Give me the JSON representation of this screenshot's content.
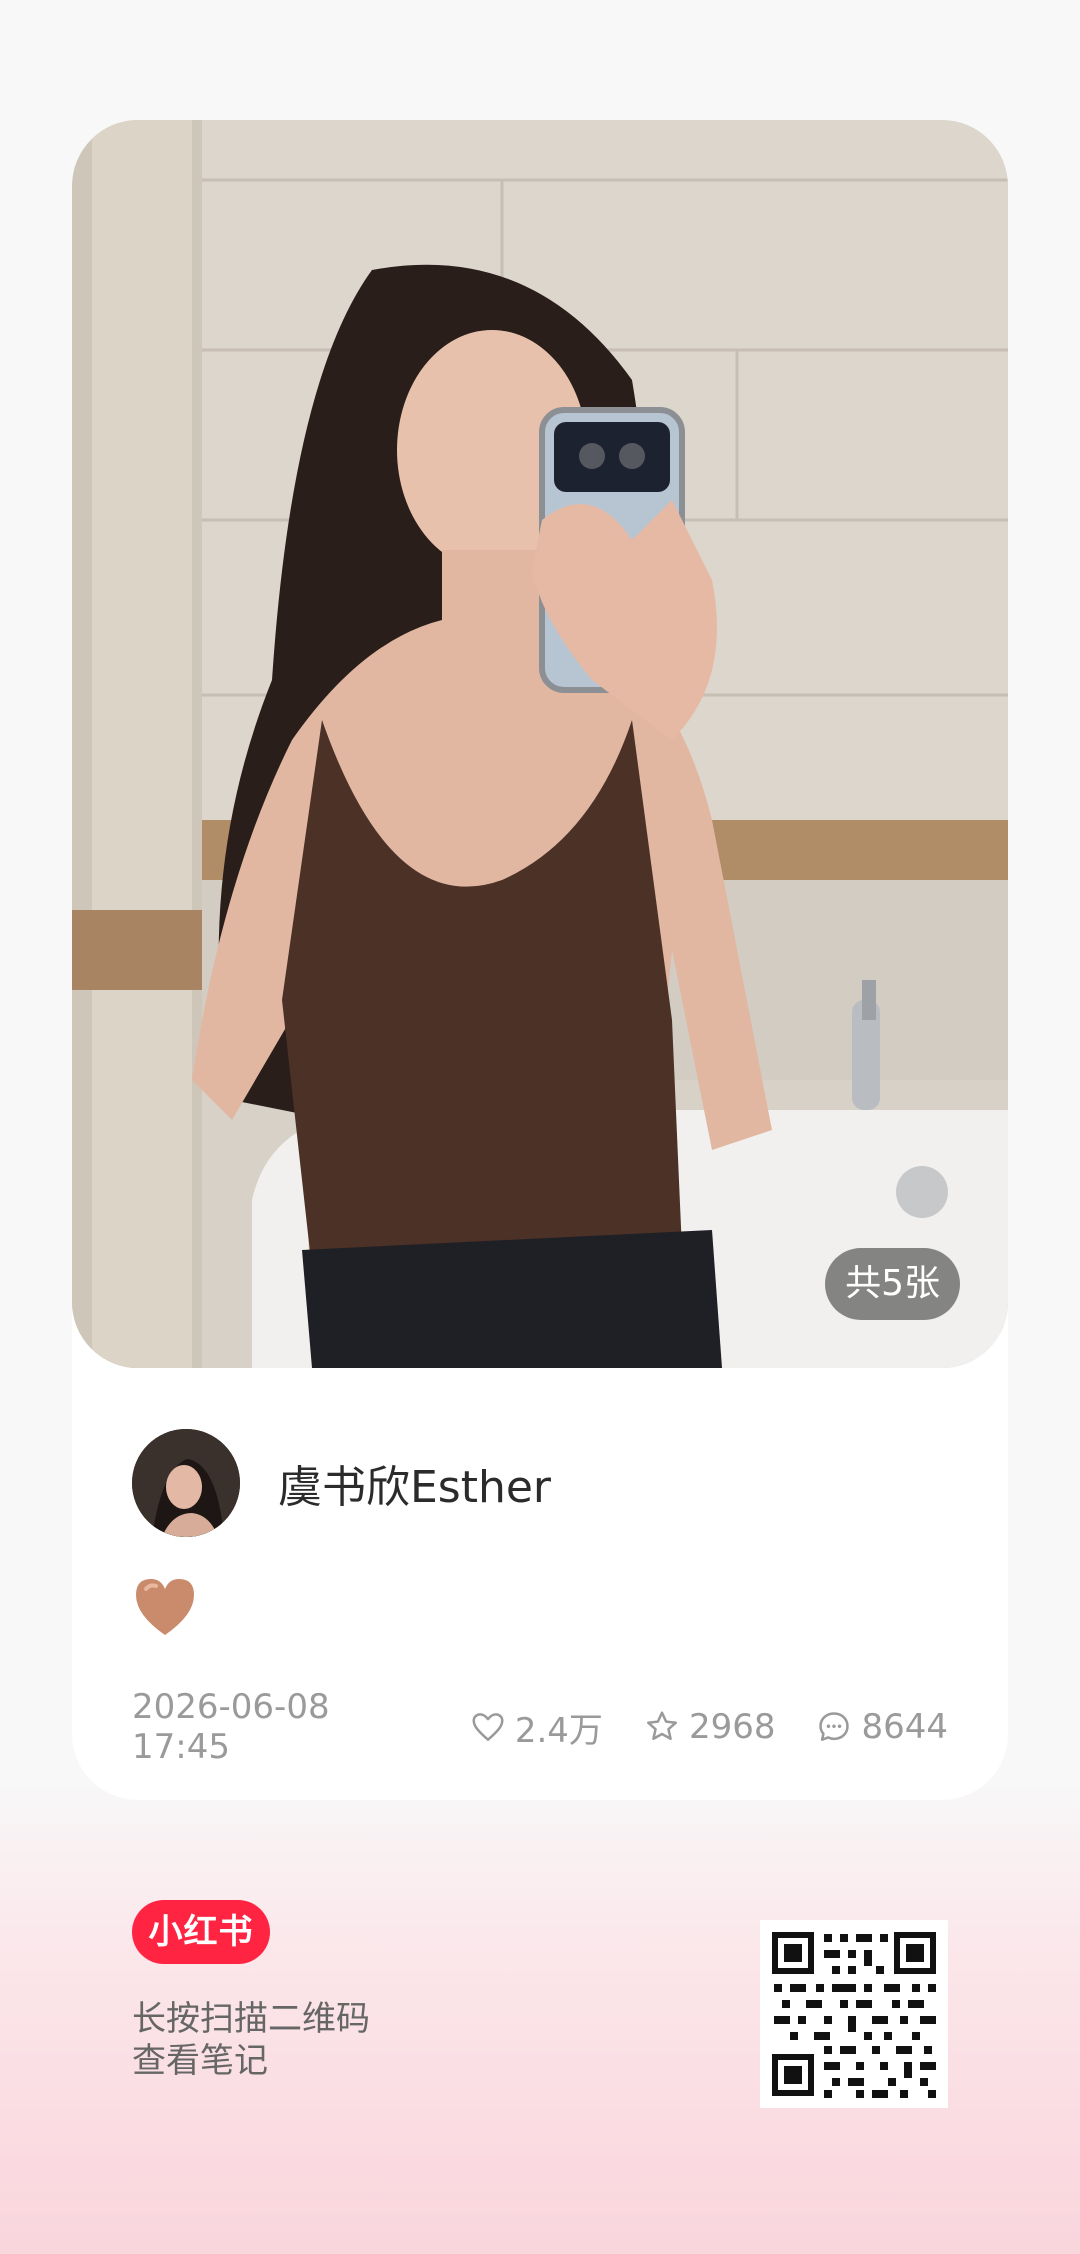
{
  "post": {
    "image_count_label": "共5张",
    "author_name": "虞书欣Esther",
    "content_emoji": "🤎",
    "date": "2026-06-08 17:45",
    "likes": "2.4万",
    "collects": "2968",
    "comments": "8644"
  },
  "footer": {
    "logo_text": "小红书",
    "scan_line1": "长按扫描二维码",
    "scan_line2": "查看笔记"
  },
  "icons": {
    "like": "heart-outline-icon",
    "collect": "star-outline-icon",
    "comment": "chat-bubble-icon",
    "qr": "qr-code-icon"
  },
  "colors": {
    "brand": "#ff2442",
    "meta_text": "#9a9a9a",
    "badge_bg": "#5a5a5a"
  }
}
